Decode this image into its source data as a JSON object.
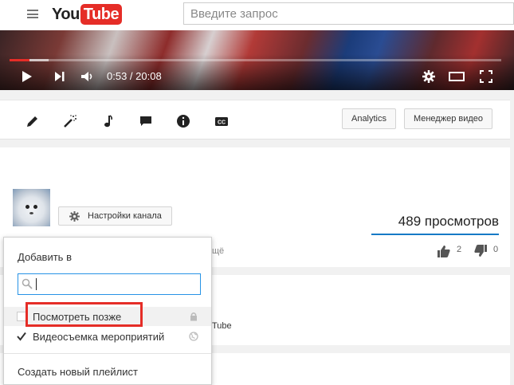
{
  "header": {
    "logo_you": "You",
    "logo_tube": "Tube",
    "search_placeholder": "Введите запрос"
  },
  "player": {
    "time": "0:53 / 20:08",
    "progress_fraction": 0.04,
    "icons": [
      "play-icon",
      "next-icon",
      "volume-icon",
      "settings-icon",
      "theater-icon",
      "fullscreen-icon"
    ]
  },
  "toolbar": {
    "icons": [
      "pencil-icon",
      "magic-wand-icon",
      "music-note-icon",
      "comment-icon",
      "info-icon",
      "cc-icon"
    ],
    "analytics_label": "Analytics",
    "video_manager_label": "Менеджер видео"
  },
  "channel": {
    "settings_label": "Настройки канала",
    "views": "489 просмотров",
    "likes": "2",
    "dislikes": "0",
    "partial_label": "щё",
    "partial_label2": "Tube"
  },
  "add_to_popup": {
    "title": "Добавить в",
    "search_value": "",
    "playlists": [
      {
        "label": "Посмотреть позже",
        "checked": false,
        "privacy_icon": "lock-icon"
      },
      {
        "label": "Видеосъемка мероприятий",
        "checked": true,
        "privacy_icon": "globe-icon"
      }
    ],
    "create_label": "Создать новый плейлист"
  },
  "colors": {
    "accent_red": "#e52d27",
    "focus_blue": "#2793e6",
    "views_underline": "#167ac6"
  }
}
